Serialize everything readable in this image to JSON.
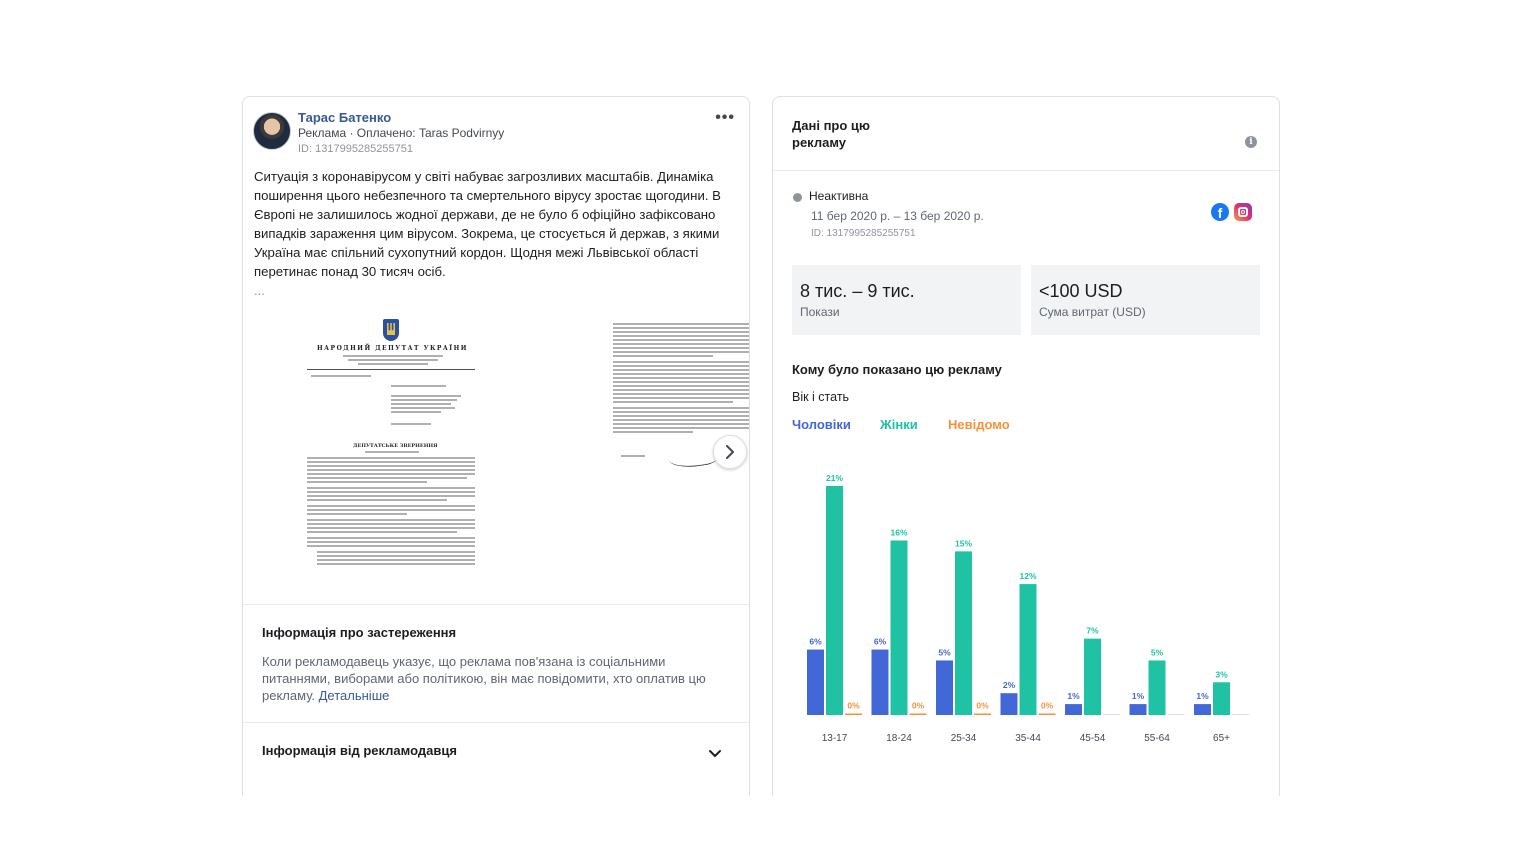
{
  "post": {
    "author": "Тарас Батенко",
    "ad_label": "Реклама · Оплачено: ",
    "paid_by": "Taras Podvirnyy",
    "id": "ID: 1317995285255751",
    "text": "Ситуація з коронавірусом у світі набуває загрозливих масштабів. Динаміка поширення цього небезпечного та смертельного вірусу зростає щогодини. В Європі не залишилось жодної держави, де не було б офіційно зафіксовано випадків зараження цим вірусом. Зокрема, це стосується й держав, з якими Україна має спільний сухопутний кордон. Щодня межі Львівської області перетинає понад 30 тисяч осіб.",
    "more": "...",
    "doc_heading": "НАРОДНИЙ ДЕПУТАТ УКРАЇНИ",
    "doc_title": "ДЕПУТАТСЬКЕ ЗВЕРНЕННЯ"
  },
  "disclaimer": {
    "title": "Інформація про застереження",
    "text": "Коли рекламодавець указує, що реклама пов'язана із соціальними питаннями, виборами або політикою, він має повідомити, хто оплатив цю рекламу. ",
    "link": "Детальніше"
  },
  "advertiser": {
    "title": "Інформація від рекламодавця"
  },
  "ad_data": {
    "title": "Дані про цю рекламу",
    "status": "Неактивна",
    "dates": "11 бер 2020 р. – 13 бер 2020 р.",
    "id": "ID: 1317995285255751",
    "impressions_value": "8 тис. – 9 тис.",
    "impressions_label": "Покази",
    "spend_value": "<100 USD",
    "spend_label": "Сума витрат (USD)",
    "shown_title": "Кому було показано цю рекламу",
    "age_gender": "Вік і стать"
  },
  "colors": {
    "men": "#4267d6",
    "women": "#1fc3a3",
    "unknown": "#f7923a"
  },
  "chart_data": {
    "type": "bar",
    "categories": [
      "13-17",
      "18-24",
      "25-34",
      "35-44",
      "45-54",
      "55-64",
      "65+"
    ],
    "series": [
      {
        "name": "Чоловіки",
        "values": [
          6,
          6,
          5,
          2,
          1,
          1,
          1
        ]
      },
      {
        "name": "Жінки",
        "values": [
          21,
          16,
          15,
          12,
          7,
          5,
          3
        ]
      },
      {
        "name": "Невідомо",
        "values": [
          0,
          0,
          0,
          0,
          null,
          null,
          null
        ]
      }
    ],
    "value_suffix": "%",
    "ylim": [
      0,
      22
    ]
  }
}
